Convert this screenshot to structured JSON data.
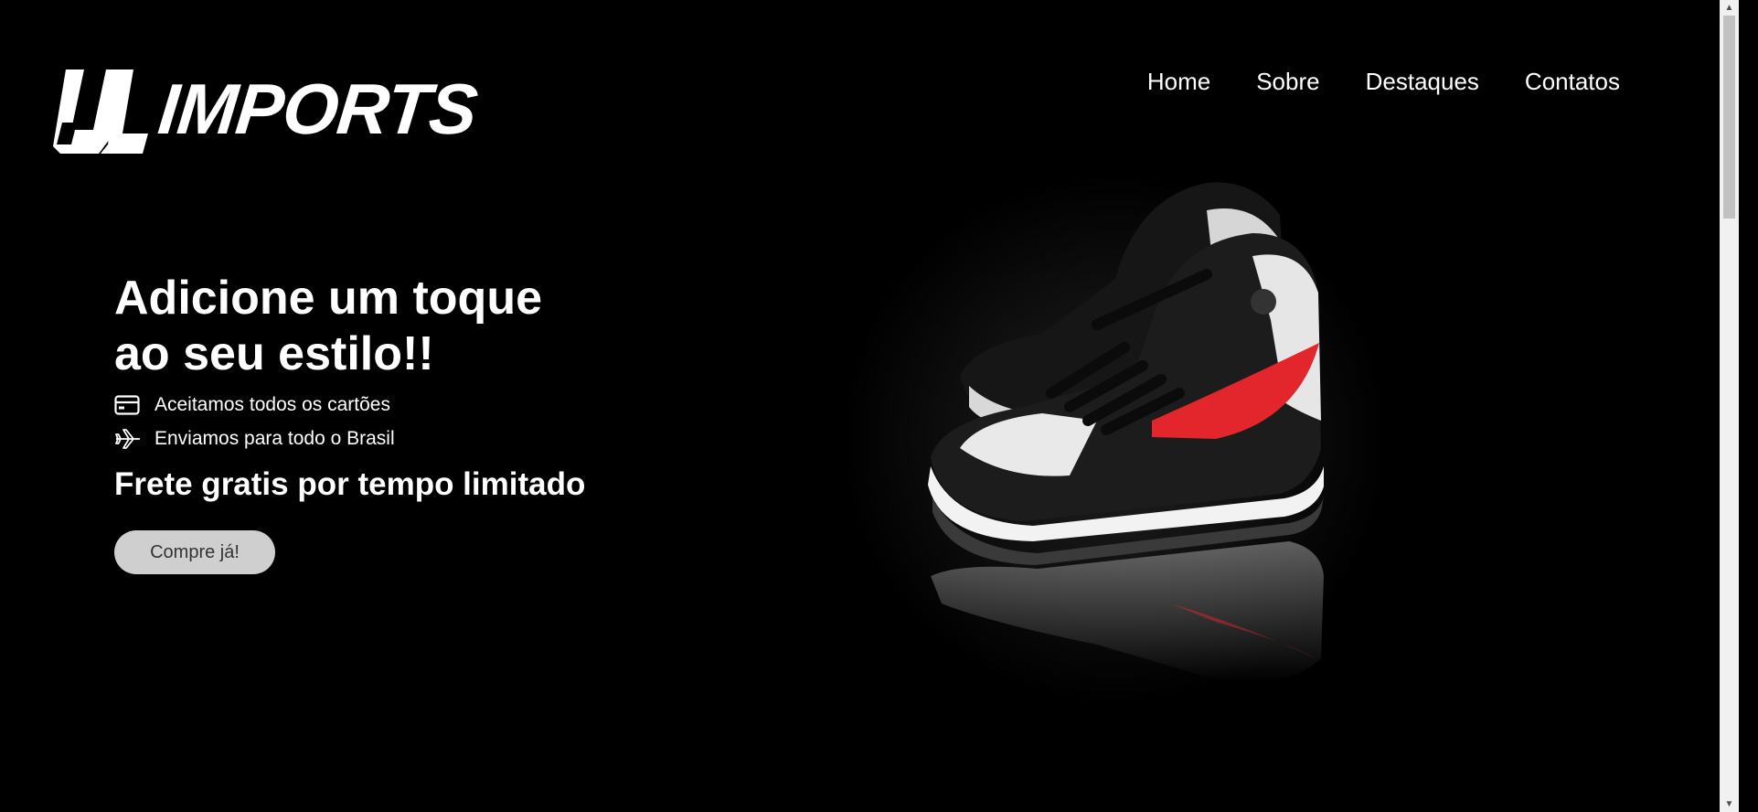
{
  "brand": {
    "name": "IMPORTS"
  },
  "nav": {
    "items": [
      {
        "label": "Home"
      },
      {
        "label": "Sobre"
      },
      {
        "label": "Destaques"
      },
      {
        "label": "Contatos"
      }
    ]
  },
  "hero": {
    "title_line1": "Adicione um toque",
    "title_line2": "ao seu estilo!!",
    "features": [
      {
        "icon": "credit-card-icon",
        "text": "Aceitamos todos os cartões"
      },
      {
        "icon": "airplane-icon",
        "text": "Enviamos para todo o Brasil"
      }
    ],
    "promo": "Frete gratis por tempo limitado",
    "cta_label": "Compre já!"
  },
  "product": {
    "image": "black-white-red-high-top-sneaker"
  },
  "colors": {
    "background": "#000000",
    "text": "#ffffff",
    "button_bg": "#cfcfcf",
    "accent_red": "#e0262a"
  }
}
